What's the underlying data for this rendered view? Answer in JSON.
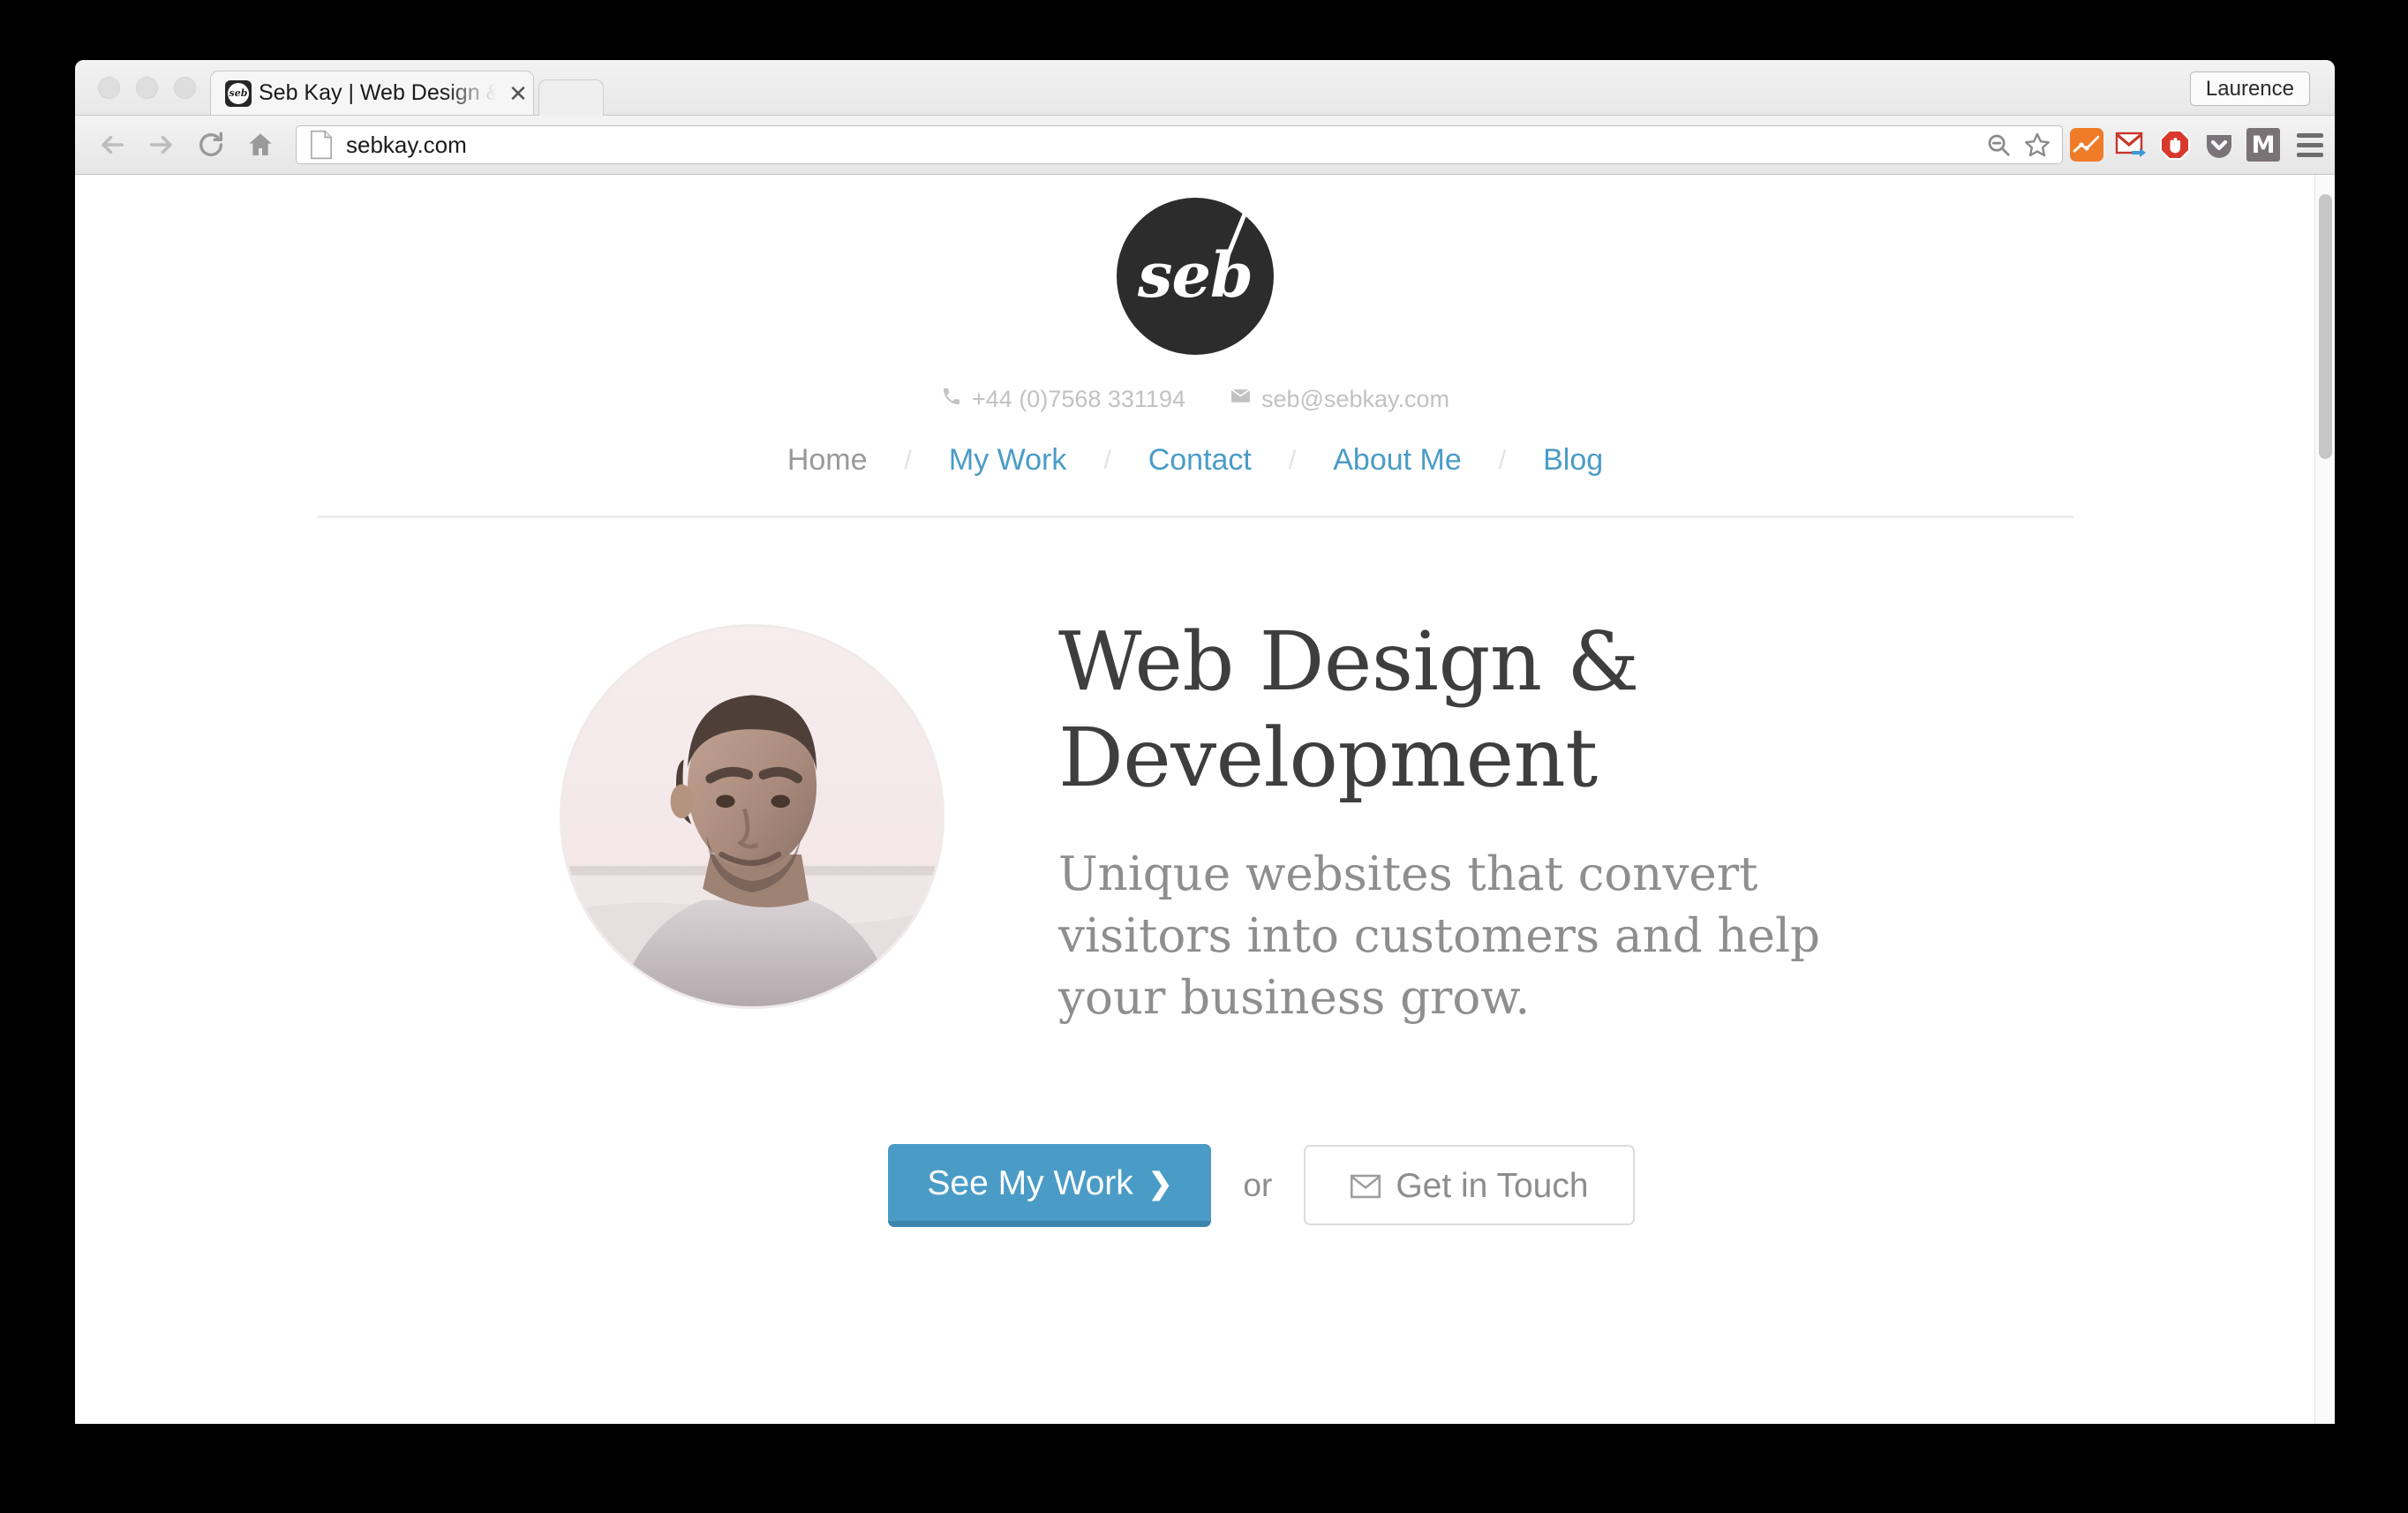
{
  "browser": {
    "tab": {
      "title": "Seb Kay | Web Design & De",
      "close_label": "✕",
      "favicon_text": "seb"
    },
    "profile_label": "Laurence",
    "url": "sebkay.com",
    "icons": {
      "back": "back-arrow-icon",
      "forward": "forward-arrow-icon",
      "reload": "reload-icon",
      "home": "home-icon",
      "page": "page-icon",
      "zoom_out": "zoom-out-icon",
      "bookmark": "bookmark-star-icon",
      "analytics": "google-analytics-icon",
      "gmail": "gmail-checker-icon",
      "adblock": "adblock-icon",
      "pocket": "pocket-icon",
      "mega": "mega-icon",
      "menu": "hamburger-menu-icon"
    },
    "mega_letter": "M"
  },
  "site": {
    "logo_text": "seb",
    "contact": {
      "phone": "+44 (0)7568 331194",
      "email": "seb@sebkay.com",
      "phone_icon": "phone-icon",
      "email_icon": "envelope-icon"
    },
    "nav": {
      "separator": "/",
      "items": [
        {
          "label": "Home",
          "active": true
        },
        {
          "label": "My Work",
          "active": false
        },
        {
          "label": "Contact",
          "active": false
        },
        {
          "label": "About Me",
          "active": false
        },
        {
          "label": "Blog",
          "active": false
        }
      ]
    },
    "hero": {
      "title": "Web Design & Development",
      "subtitle": "Unique websites that convert visitors into customers and help your business grow.",
      "photo_alt": "portrait-photo",
      "primary_cta": "See My Work",
      "primary_cta_chevron": "❯",
      "or_label": "or",
      "secondary_cta": "Get in Touch"
    }
  },
  "colors": {
    "accent_blue": "#4a9cc7",
    "accent_blue_dark": "#3c86ae",
    "logo_dark": "#2c2c2c",
    "heading_gray": "#3e3e3e",
    "body_gray": "#8e8e8e",
    "muted_gray": "#c2c2c2",
    "rule_gray": "#ededed"
  }
}
